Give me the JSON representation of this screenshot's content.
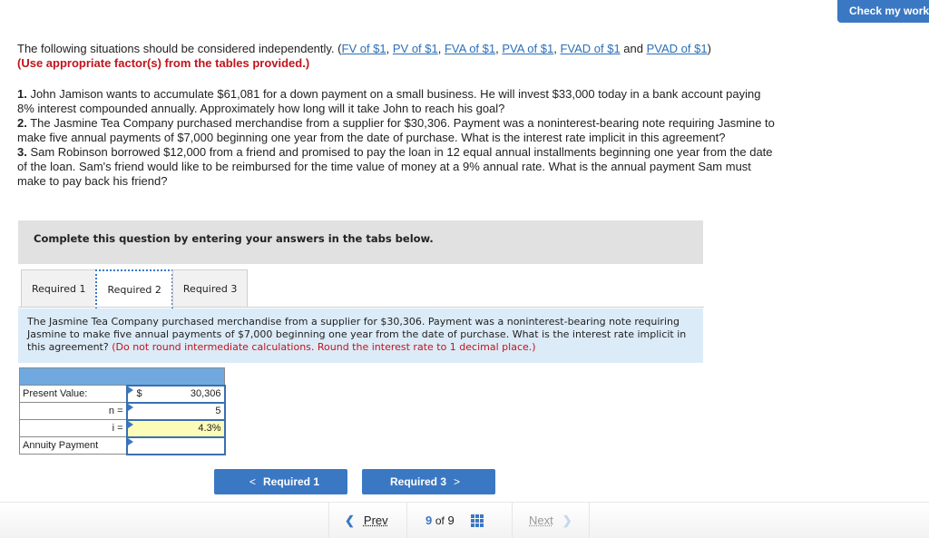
{
  "header": {
    "check_my_work": "Check my work"
  },
  "intro": {
    "text": "The following situations should be considered independently. (",
    "links": [
      "FV of $1",
      "PV of $1",
      "FVA of $1",
      "PVA of $1",
      "FVAD of $1",
      "PVAD of $1"
    ],
    "sep": ", ",
    "and": " and ",
    "close": ")",
    "instruction": "(Use appropriate factor(s) from the tables provided.)"
  },
  "problems": [
    {
      "num": "1.",
      "text": " John Jamison wants to accumulate $61,081 for a down payment on a small business. He will invest $33,000 today in a bank account paying 8% interest compounded annually. Approximately how long will it take John to reach his goal?"
    },
    {
      "num": "2.",
      "text": " The Jasmine Tea Company purchased merchandise from a supplier for $30,306. Payment was a noninterest-bearing note requiring Jasmine to make five annual payments of $7,000 beginning one year from the date of purchase. What is the interest rate implicit in this agreement?"
    },
    {
      "num": "3.",
      "text": " Sam Robinson borrowed $12,000 from a friend and promised to pay the loan in 12 equal annual installments beginning one year from the date of the loan. Sam's friend would like to be reimbursed for the time value of money at a 9% annual rate. What is the annual payment Sam must make to pay back his friend?"
    }
  ],
  "complete_box": "Complete this question by entering your answers in the tabs below.",
  "tabs": [
    {
      "label": "Required 1",
      "active": false
    },
    {
      "label": "Required 2",
      "active": true
    },
    {
      "label": "Required 3",
      "active": false
    }
  ],
  "question": {
    "text": "The Jasmine Tea Company purchased merchandise from a supplier for $30,306. Payment was a noninterest-bearing note requiring Jasmine to make five annual payments of $7,000 beginning one year from the date of purchase. What is the interest rate implicit in this agreement? ",
    "instruction": "(Do not round intermediate calculations. Round the interest rate to 1 decimal place.)"
  },
  "calc_table": {
    "rows": [
      {
        "label": "Present Value:",
        "currency": "$",
        "value": "30,306"
      },
      {
        "label": "n =",
        "value": "5"
      },
      {
        "label": "i =",
        "value": "4.3%"
      },
      {
        "label": "Annuity Payment",
        "value": ""
      }
    ]
  },
  "nav": {
    "prev_label": "Required 1",
    "prev_chevron": "<",
    "next_label": "Required 3",
    "next_chevron": ">"
  },
  "footer": {
    "prev": "Prev",
    "prev_chevron": "❮",
    "current": "9",
    "of": "of",
    "total": "9",
    "next": "Next",
    "next_chevron": "❯"
  }
}
